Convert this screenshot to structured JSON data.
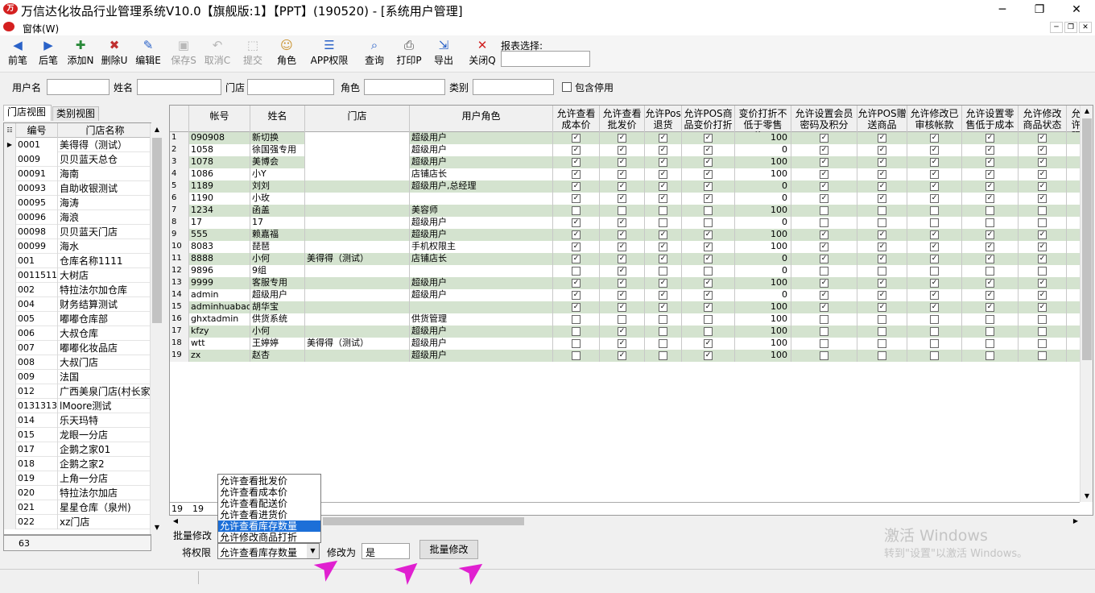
{
  "window": {
    "title": "万信达化妆品行业管理系统V10.0【旗舰版:1】【PPT】(190520) - [系统用户管理]",
    "menu_label": "窗体(W)",
    "min_glyph": "─",
    "max_glyph": "❐",
    "close_glyph": "✕"
  },
  "toolbar": {
    "items": [
      {
        "label": "前笔",
        "icon": "◀"
      },
      {
        "label": "后笔",
        "icon": "▶"
      },
      {
        "label": "添加N",
        "icon": "✚"
      },
      {
        "label": "删除U",
        "icon": "✖"
      },
      {
        "label": "编辑E",
        "icon": "✎"
      },
      {
        "label": "保存S",
        "icon": "▣"
      },
      {
        "label": "取消C",
        "icon": "↶"
      },
      {
        "label": "提交",
        "icon": "⬚"
      },
      {
        "label": "角色",
        "icon": "☺"
      },
      {
        "label": "APP权限",
        "icon": "☰"
      },
      {
        "label": "查询",
        "icon": "⌕"
      },
      {
        "label": "打印P",
        "icon": "⎙"
      },
      {
        "label": "导出",
        "icon": "⇲"
      },
      {
        "label": "关闭Q",
        "icon": "✕"
      }
    ],
    "report_label": "报表选择:"
  },
  "filters": {
    "user_label": "用户名",
    "name_label": "姓名",
    "store_label": "门店",
    "role_label": "角色",
    "category_label": "类别",
    "include_disabled": "包含停用"
  },
  "left_panel": {
    "tabs": [
      "门店视图",
      "类别视图"
    ],
    "columns": [
      "编号",
      "门店名称"
    ],
    "rows": [
      [
        "0001",
        "美得得（测试）"
      ],
      [
        "0009",
        "贝贝蓝天总仓"
      ],
      [
        "00091",
        "海南"
      ],
      [
        "00093",
        "自助收银测试"
      ],
      [
        "00095",
        "海涛"
      ],
      [
        "00096",
        "海浪"
      ],
      [
        "00098",
        "贝贝蓝天门店"
      ],
      [
        "00099",
        "海水"
      ],
      [
        "001",
        "仓库名称1111"
      ],
      [
        "0011511",
        "大树店"
      ],
      [
        "002",
        "特拉法尔加仓库"
      ],
      [
        "004",
        "财务结算测试"
      ],
      [
        "005",
        "嘟嘟仓库部"
      ],
      [
        "006",
        "大叔仓库"
      ],
      [
        "007",
        "嘟嘟化妆品店"
      ],
      [
        "008",
        "大叔门店"
      ],
      [
        "009",
        "法国"
      ],
      [
        "012",
        "广西美泉门店(村长家"
      ],
      [
        "0131313",
        "lMoore测试"
      ],
      [
        "014",
        "乐天玛特"
      ],
      [
        "015",
        "龙眼一分店"
      ],
      [
        "017",
        "企鹅之家01"
      ],
      [
        "018",
        "企鹅之家2"
      ],
      [
        "019",
        "上角一分店"
      ],
      [
        "020",
        "特拉法尔加店"
      ],
      [
        "021",
        "星星仓库（泉州)"
      ],
      [
        "022",
        "xz门店"
      ]
    ],
    "count": "63"
  },
  "grid": {
    "columns": [
      "帐号",
      "姓名",
      "门店",
      "用户角色",
      "允许查看成本价",
      "允许查看批发价",
      "允许Pos退货",
      "允许POS商品变价打折",
      "变价打折不低于零售价%",
      "允许设置会员密码及积分",
      "允许POS赠送商品",
      "允许修改已审核帐款",
      "允许设置零售低于成本",
      "允许修改商品状态",
      "允许限"
    ],
    "rows": [
      {
        "n": "1",
        "acct": "090908",
        "name": "新切换",
        "store": "",
        "role": "超级用户",
        "pct": "100",
        "cb": [
          1,
          1,
          1,
          1,
          1,
          1,
          1,
          1,
          1
        ]
      },
      {
        "n": "2",
        "acct": "1058",
        "name": "徐国强专用",
        "store": "",
        "role": "超级用户",
        "pct": "0",
        "cb": [
          1,
          1,
          1,
          1,
          1,
          1,
          1,
          1,
          1
        ]
      },
      {
        "n": "3",
        "acct": "1078",
        "name": "美博会",
        "store": "",
        "role": "超级用户",
        "pct": "100",
        "cb": [
          1,
          1,
          1,
          1,
          1,
          1,
          1,
          1,
          1
        ]
      },
      {
        "n": "4",
        "acct": "1086",
        "name": "小Y",
        "store": "",
        "role": "店铺店长",
        "pct": "100",
        "cb": [
          1,
          1,
          1,
          1,
          1,
          1,
          1,
          1,
          1
        ]
      },
      {
        "n": "5",
        "acct": "1189",
        "name": "刘刘",
        "store": "",
        "role": "超级用户,总经理",
        "pct": "0",
        "cb": [
          1,
          1,
          1,
          1,
          1,
          1,
          1,
          1,
          1
        ]
      },
      {
        "n": "6",
        "acct": "1190",
        "name": "小玫",
        "store": "",
        "role": "",
        "pct": "0",
        "cb": [
          1,
          1,
          1,
          1,
          1,
          1,
          1,
          1,
          1
        ]
      },
      {
        "n": "7",
        "acct": "1234",
        "name": "函盖",
        "store": "",
        "role": "美容师",
        "pct": "100",
        "cb": [
          0,
          0,
          0,
          0,
          0,
          0,
          0,
          0,
          0
        ]
      },
      {
        "n": "8",
        "acct": "17",
        "name": "17",
        "store": "",
        "role": "超级用户",
        "pct": "0",
        "cb": [
          1,
          1,
          0,
          0,
          0,
          0,
          0,
          0,
          0
        ]
      },
      {
        "n": "9",
        "acct": "555",
        "name": "赖嘉福",
        "store": "",
        "role": "超级用户",
        "pct": "100",
        "cb": [
          1,
          1,
          1,
          1,
          1,
          1,
          1,
          1,
          1
        ]
      },
      {
        "n": "10",
        "acct": "8083",
        "name": "琵琶",
        "store": "",
        "role": "手机权限主",
        "pct": "100",
        "cb": [
          1,
          1,
          1,
          1,
          1,
          1,
          1,
          1,
          1
        ]
      },
      {
        "n": "11",
        "acct": "8888",
        "name": "小何",
        "store": "美得得（测试）",
        "role": "店铺店长",
        "pct": "0",
        "cb": [
          1,
          1,
          1,
          1,
          1,
          1,
          1,
          1,
          1
        ]
      },
      {
        "n": "12",
        "acct": "9896",
        "name": "9组",
        "store": "",
        "role": "",
        "pct": "0",
        "cb": [
          0,
          1,
          0,
          0,
          0,
          0,
          0,
          0,
          0
        ]
      },
      {
        "n": "13",
        "acct": "9999",
        "name": "客服专用",
        "store": "",
        "role": "超级用户",
        "pct": "100",
        "cb": [
          1,
          1,
          1,
          1,
          1,
          1,
          1,
          1,
          1
        ]
      },
      {
        "n": "14",
        "acct": "admin",
        "name": "超级用户",
        "store": "",
        "role": "超级用户",
        "pct": "0",
        "cb": [
          1,
          1,
          1,
          1,
          1,
          1,
          1,
          1,
          1
        ]
      },
      {
        "n": "15",
        "acct": "adminhuabao",
        "name": "胡华宝",
        "store": "",
        "role": "",
        "pct": "100",
        "cb": [
          1,
          1,
          1,
          1,
          1,
          1,
          1,
          1,
          1
        ]
      },
      {
        "n": "16",
        "acct": "ghxtadmin",
        "name": "供货系统",
        "store": "",
        "role": "供货管理",
        "pct": "100",
        "cb": [
          0,
          0,
          0,
          0,
          0,
          0,
          0,
          0,
          0
        ]
      },
      {
        "n": "17",
        "acct": "kfzy",
        "name": "小何",
        "store": "",
        "role": "超级用户",
        "pct": "100",
        "cb": [
          0,
          1,
          0,
          0,
          0,
          0,
          0,
          0,
          0
        ]
      },
      {
        "n": "18",
        "acct": "wtt",
        "name": "王婷婷",
        "store": "美得得（测试）",
        "role": "超级用户",
        "pct": "100",
        "cb": [
          0,
          1,
          0,
          1,
          0,
          0,
          0,
          0,
          0
        ]
      },
      {
        "n": "19",
        "acct": "zx",
        "name": "赵杏",
        "store": "",
        "role": "超级用户",
        "pct": "100",
        "cb": [
          0,
          1,
          0,
          1,
          0,
          0,
          0,
          0,
          0
        ]
      }
    ],
    "footer_count": "19",
    "footer_acct": "19"
  },
  "batch": {
    "section_label": "批量修改",
    "perm_label": "将权限",
    "selected": "允许查看库存数量",
    "change_to_label": "修改为",
    "change_to_value": "是",
    "button_label": "批量修改",
    "options": [
      "允许查看批发价",
      "允许查看成本价",
      "允许查看配送价",
      "允许查看进货价",
      "允许查看库存数量",
      "允许修改商品打折"
    ],
    "highlighted_index": 4
  },
  "watermark": {
    "line1": "激活 Windows",
    "line2": "转到\"设置\"以激活 Windows。"
  }
}
